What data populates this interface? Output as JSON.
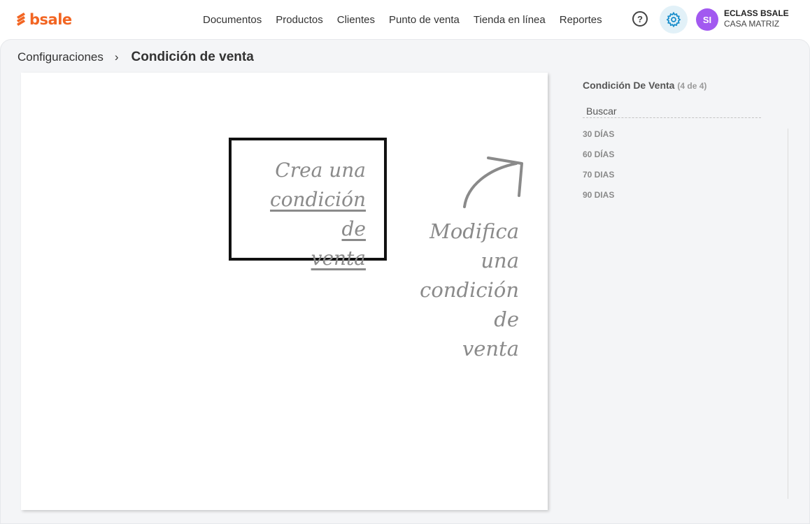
{
  "brand": {
    "name": "bsale",
    "color": "#f26522"
  },
  "nav": {
    "items": [
      {
        "label": "Documentos"
      },
      {
        "label": "Productos"
      },
      {
        "label": "Clientes"
      },
      {
        "label": "Punto de venta"
      },
      {
        "label": "Tienda en línea"
      },
      {
        "label": "Reportes"
      }
    ]
  },
  "toolbar": {
    "help_icon": "question-circle-icon",
    "settings_icon": "gear-icon",
    "settings_accent": "#1a8ecb"
  },
  "user": {
    "initials": "SI",
    "name": "ECLASS BSALE",
    "branch": "CASA MATRIZ",
    "avatar_color": "#a259f0"
  },
  "breadcrumb": {
    "parent": "Configuraciones",
    "separator": "›",
    "current": "Condición de venta"
  },
  "canvas": {
    "create_line1": "Crea una",
    "create_line2": "condición de",
    "create_line3": "venta",
    "modify_line1": "Modifica una",
    "modify_line2": "condición de",
    "modify_line3": "venta"
  },
  "sidebar": {
    "title": "Condición De Venta",
    "count": "(4 de 4)",
    "search_placeholder": "Buscar",
    "items": [
      {
        "label": "30 DÍAS"
      },
      {
        "label": "60 DÍAS"
      },
      {
        "label": "70 DIAS"
      },
      {
        "label": "90 DIAS"
      }
    ]
  }
}
